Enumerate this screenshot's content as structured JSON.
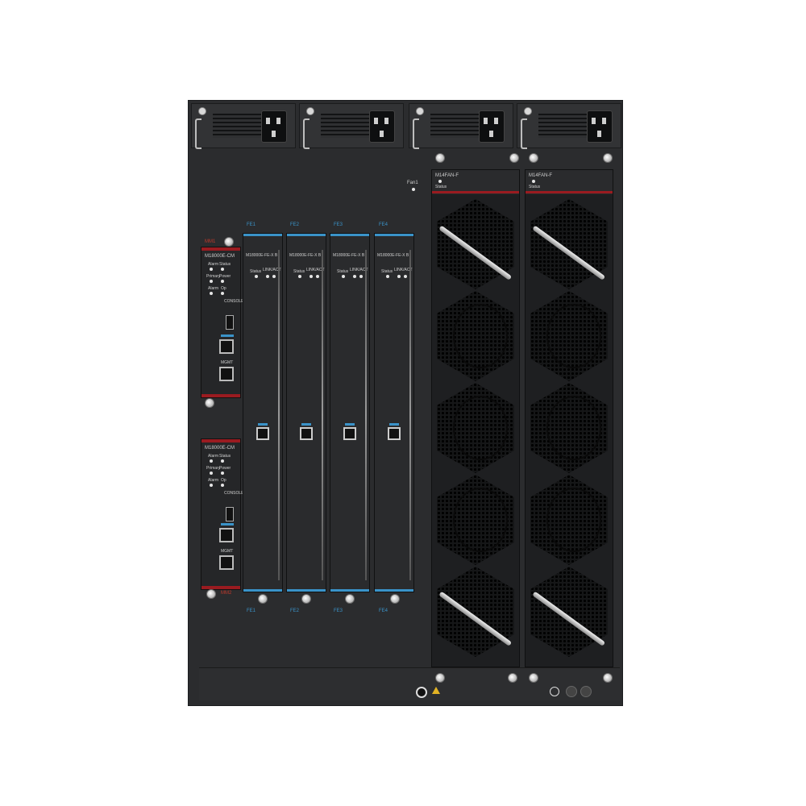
{
  "cm_slots": [
    {
      "slot_label": "MM1",
      "model": "M18000E-CM",
      "led_labels": [
        "Alarm",
        "Status",
        "Primary",
        "Power",
        "Alarm",
        "Op"
      ],
      "port_label": "CONSOLE",
      "mgmt_label": "MGMT"
    },
    {
      "slot_label": "MM2",
      "model": "M18000E-CM",
      "led_labels": [
        "Alarm",
        "Status",
        "Primary",
        "Power",
        "Alarm",
        "Op"
      ],
      "port_label": "CONSOLE",
      "mgmt_label": "MGMT"
    }
  ],
  "fe_slots": [
    {
      "top_label": "FE1",
      "bottom_label": "FE1",
      "model": "M18000E-FE-X B",
      "led_labels": [
        "Status",
        "LINK/ACT"
      ]
    },
    {
      "top_label": "FE2",
      "bottom_label": "FE2",
      "model": "M18000E-FE-X B",
      "led_labels": [
        "Status",
        "LINK/ACT"
      ]
    },
    {
      "top_label": "FE3",
      "bottom_label": "FE3",
      "model": "M18000E-FE-X B",
      "led_labels": [
        "Status",
        "LINK/ACT"
      ]
    },
    {
      "top_label": "FE4",
      "bottom_label": "FE4",
      "model": "M18000E-FE-X B",
      "led_labels": [
        "Status",
        "LINK/ACT"
      ]
    }
  ],
  "fan_trays": [
    {
      "model": "M14FAN-F",
      "status_label": "Status"
    },
    {
      "model": "M14FAN-F",
      "status_label": "Status"
    }
  ],
  "chassis": {
    "fan_label": "Fan1"
  },
  "colors": {
    "chassis": "#2b2c2e",
    "accent_red": "#9a1b20",
    "accent_blue": "#3a93c9",
    "fan_grille": "#151617"
  },
  "icons": [
    "power-socket-icon",
    "screw-icon",
    "rj45-port-icon",
    "usb-port-icon",
    "fan-grille-icon",
    "ground-icon",
    "warning-icon"
  ]
}
